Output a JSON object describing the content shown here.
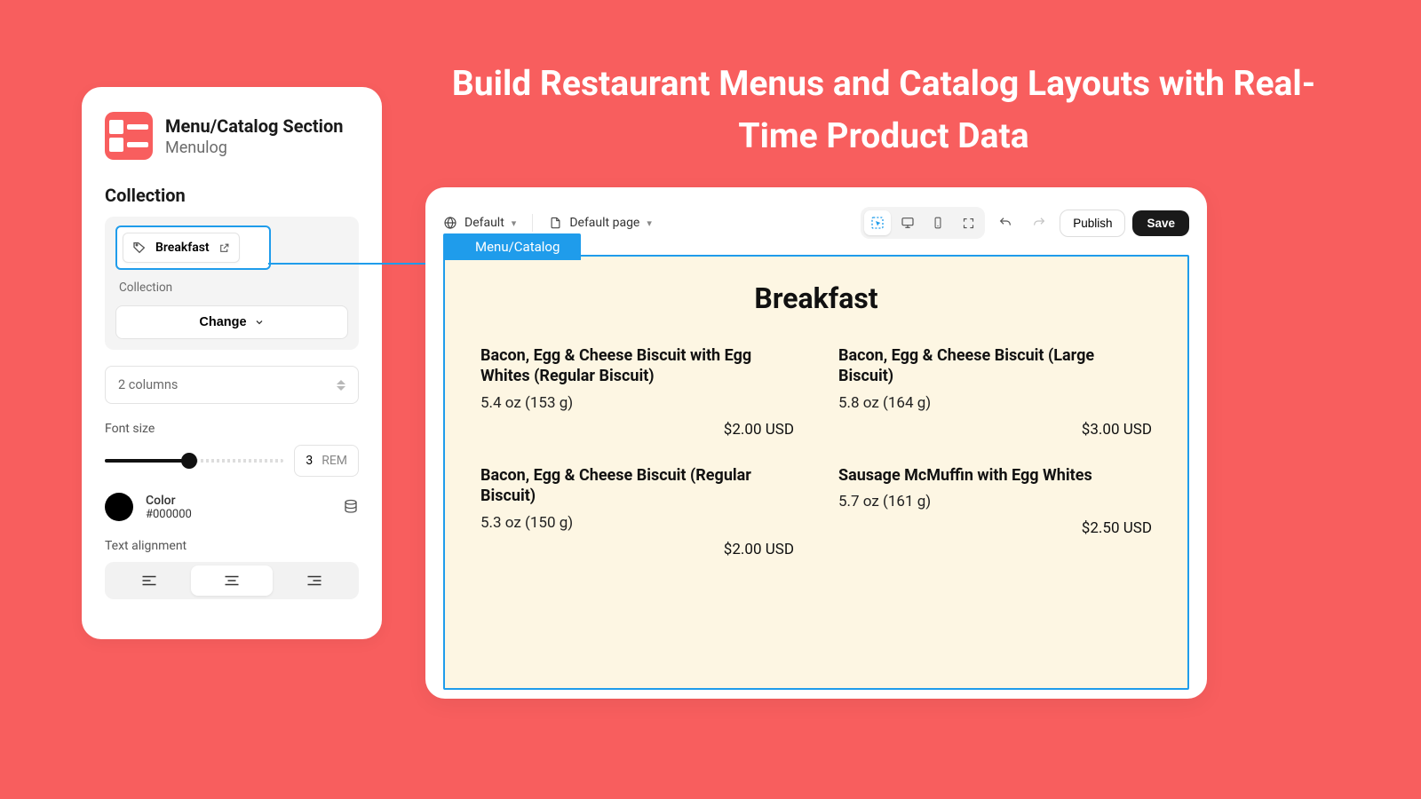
{
  "headline": "Build Restaurant Menus and Catalog Layouts with Real-Time Product Data",
  "panel": {
    "title": "Menu/Catalog Section",
    "subtitle": "Menulog",
    "section_label": "Collection",
    "collection_chip": "Breakfast",
    "collection_caption": "Collection",
    "change_label": "Change",
    "columns_value": "2 columns",
    "font_size_label": "Font size",
    "font_size_value": "3",
    "font_size_unit": "REM",
    "color_label": "Color",
    "color_value": "#000000",
    "text_align_label": "Text alignment"
  },
  "preview": {
    "theme_label": "Default",
    "page_label": "Default page",
    "publish_label": "Publish",
    "save_label": "Save",
    "canvas_tab": "Menu/Catalog",
    "menu_title": "Breakfast",
    "items": [
      {
        "name": "Bacon, Egg & Cheese Biscuit with Egg Whites (Regular Biscuit)",
        "sub": "5.4 oz (153 g)",
        "price": "$2.00 USD"
      },
      {
        "name": "Bacon, Egg & Cheese Biscuit (Large Biscuit)",
        "sub": "5.8 oz (164 g)",
        "price": "$3.00 USD"
      },
      {
        "name": "Bacon, Egg & Cheese Biscuit (Regular Biscuit)",
        "sub": "5.3 oz (150 g)",
        "price": "$2.00 USD"
      },
      {
        "name": "Sausage McMuffin with Egg Whites",
        "sub": "5.7 oz (161 g)",
        "price": "$2.50 USD"
      }
    ]
  }
}
